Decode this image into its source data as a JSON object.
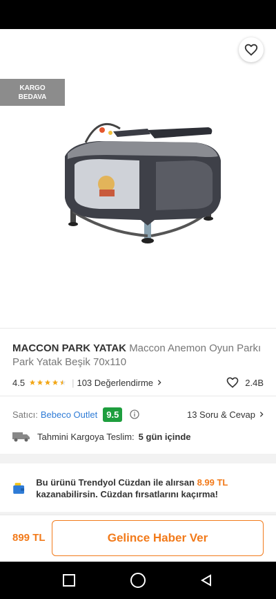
{
  "hero": {
    "cargo_badge_line1": "KARGO",
    "cargo_badge_line2": "BEDAVA",
    "icons": {
      "back": "arrow-left-icon",
      "share": "share-icon",
      "favorite": "heart-outline-icon"
    }
  },
  "product": {
    "brand": "MACCON PARK YATAK",
    "name": "Maccon Anemon Oyun Parkı Park Yatak Beşik 70x110",
    "rating": "4.5",
    "stars": 4.5,
    "reviews_label": "103 Değerlendirme",
    "favorites_count": "2.4B"
  },
  "seller": {
    "label": "Satıcı:",
    "name": "Bebeco Outlet",
    "score": "9.5",
    "qa_label": "13 Soru & Cevap"
  },
  "delivery": {
    "label": "Tahmini Kargoya Teslim:",
    "value": "5 gün içinde"
  },
  "wallet": {
    "text_before": "Bu ürünü Trendyol Cüzdan ile alırsan ",
    "amount": "8.99 TL",
    "text_after": " kazanabilirsin. Cüzdan fırsatlarını kaçırma!"
  },
  "bottom": {
    "price": "899 TL",
    "notify_label": "Gelince Haber Ver"
  },
  "colors": {
    "accent": "#f27a1a",
    "seller_link": "#2e7bd6",
    "score_badge": "#1e9e3e",
    "star": "#f2a81a"
  }
}
